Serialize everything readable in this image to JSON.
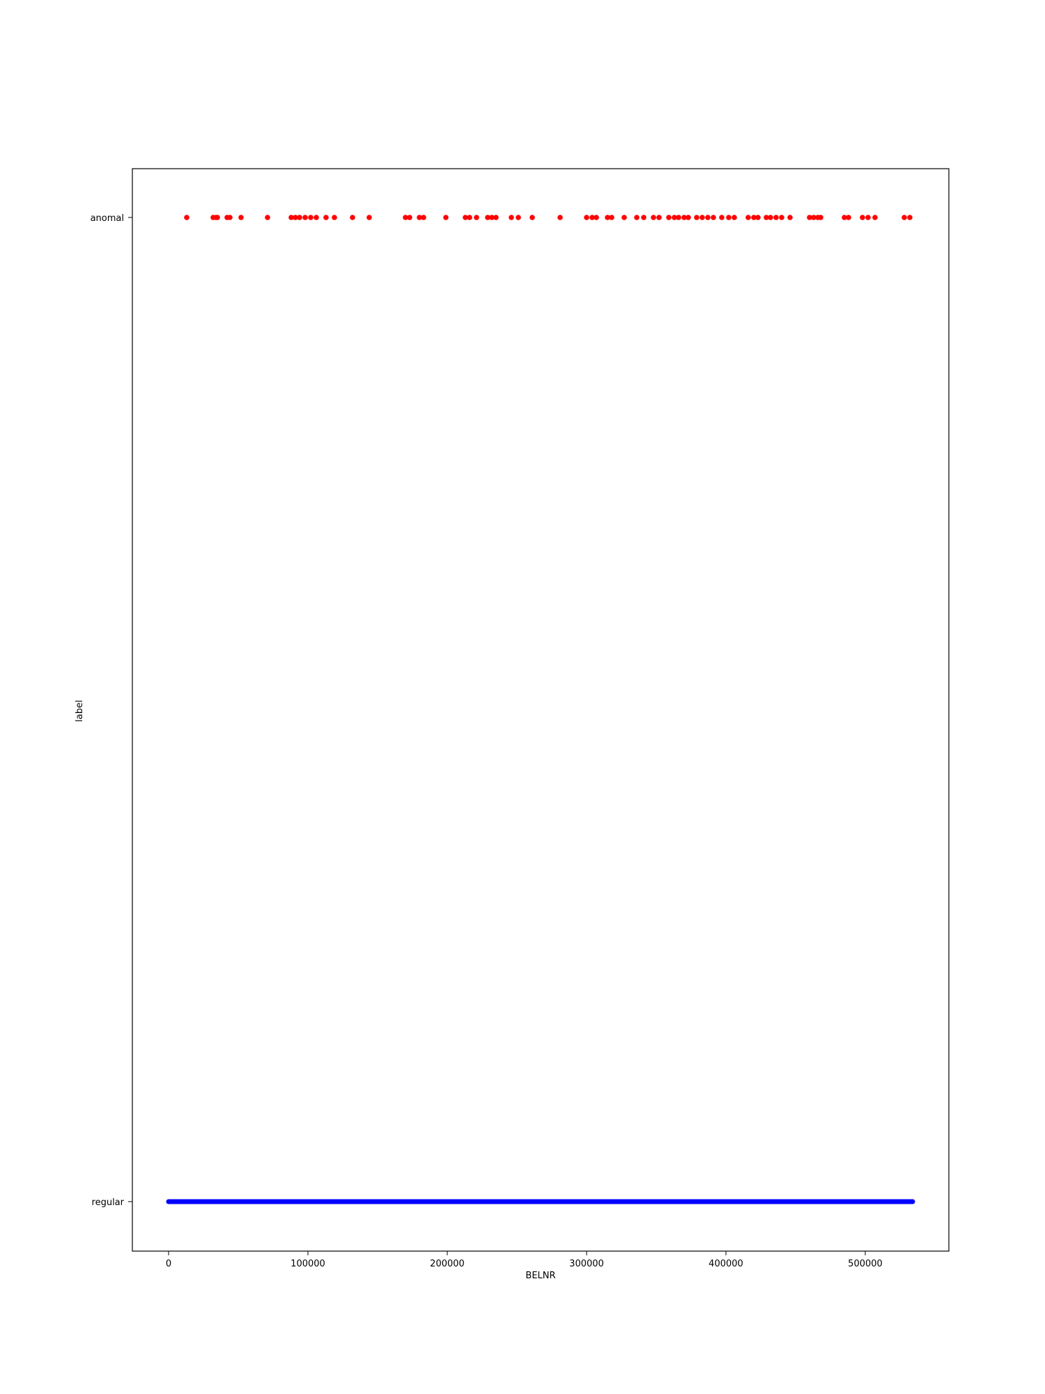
{
  "chart_data": {
    "type": "scatter",
    "title": "",
    "xlabel": "BELNR",
    "ylabel": "label",
    "xlim": [
      -26000,
      560000
    ],
    "x_ticks": [
      0,
      100000,
      200000,
      300000,
      400000,
      500000
    ],
    "x_tick_labels": [
      "0",
      "100000",
      "200000",
      "300000",
      "400000",
      "500000"
    ],
    "y_categories": [
      "regular",
      "anomal"
    ],
    "grid": false,
    "legend": "none",
    "series": [
      {
        "category": "anomal",
        "color": "#ff0000",
        "x": [
          13000,
          32000,
          34000,
          35000,
          42000,
          44000,
          52000,
          71000,
          88000,
          91000,
          94000,
          98000,
          102000,
          106000,
          113000,
          119000,
          132000,
          144000,
          170000,
          173000,
          180000,
          183000,
          199000,
          213000,
          216000,
          221000,
          229000,
          232000,
          235000,
          246000,
          251000,
          261000,
          281000,
          300000,
          304000,
          307000,
          315000,
          318000,
          327000,
          336000,
          341000,
          348000,
          352000,
          359000,
          363000,
          366000,
          370000,
          373000,
          379000,
          383000,
          387000,
          391000,
          397000,
          402000,
          406000,
          416000,
          420000,
          423000,
          429000,
          432000,
          436000,
          440000,
          446000,
          460000,
          463000,
          466000,
          468000,
          485000,
          488000,
          498000,
          502000,
          507000,
          528000,
          532000
        ]
      },
      {
        "category": "regular",
        "color": "#0000ff",
        "x_range": [
          0,
          534000
        ],
        "note_count": 533000
      }
    ]
  }
}
